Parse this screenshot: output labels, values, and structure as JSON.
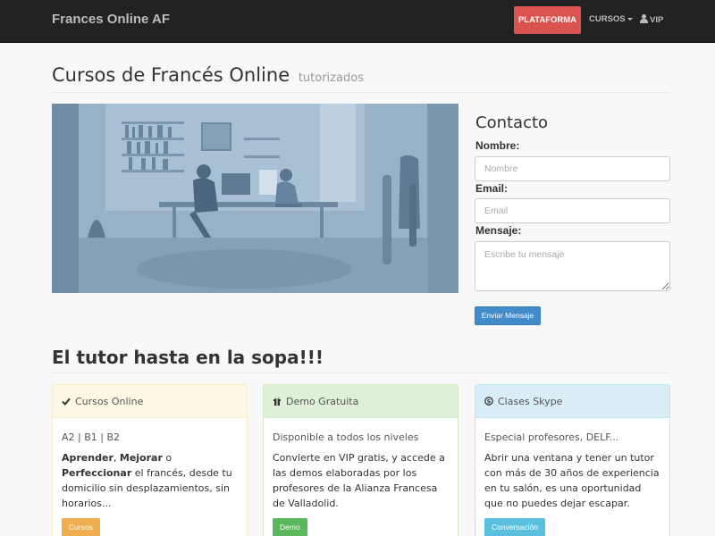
{
  "nav": {
    "brand": "Frances Online AF",
    "plataforma": "PLATAFORMA",
    "cursos": "CURSOS",
    "vip": "VIP"
  },
  "page": {
    "title": "Cursos de Francés Online",
    "title_small": "tutorizados"
  },
  "hero": {
    "image": "office-photo"
  },
  "contact": {
    "title": "Contacto",
    "nombre_label": "Nombre:",
    "nombre_placeholder": "Nombre",
    "email_label": "Email:",
    "email_placeholder": "Email",
    "mensaje_label": "Mensaje:",
    "mensaje_placeholder": "Escribe tu mensaje",
    "submit": "Enviar Mensaje"
  },
  "section": {
    "title": "El tutor hasta en la sopa!!!"
  },
  "panels": [
    {
      "heading": "Cursos Online",
      "icon": "check-icon",
      "subtitle": "A2 | B1 | B2",
      "text_parts": [
        "Aprender",
        ", ",
        "Mejorar",
        " o ",
        "Perfeccionar",
        " el francés, desde tu domicilio sin desplazamientos, sin horarios..."
      ],
      "button": "Cursos",
      "color": "#f0ad4e"
    },
    {
      "heading": "Demo Gratuita",
      "icon": "gift-icon",
      "subtitle": "Disponible a todos los niveles",
      "text": "Convierte en VIP gratis, y accede a las demos elaboradas por los profesores de la Alianza Francesa de Valladolid.",
      "button": "Demo",
      "color": "#5cb85c"
    },
    {
      "heading": "Clases Skype",
      "icon": "skype-icon",
      "subtitle": "Especial profesores, DELF...",
      "text": "Abrir una ventana y tener un tutor con más de 30 años de experiencia en tu salón, es una oportunidad que no puedes dejar escapar.",
      "button": "Conversación",
      "color": "#5bc0de"
    }
  ]
}
